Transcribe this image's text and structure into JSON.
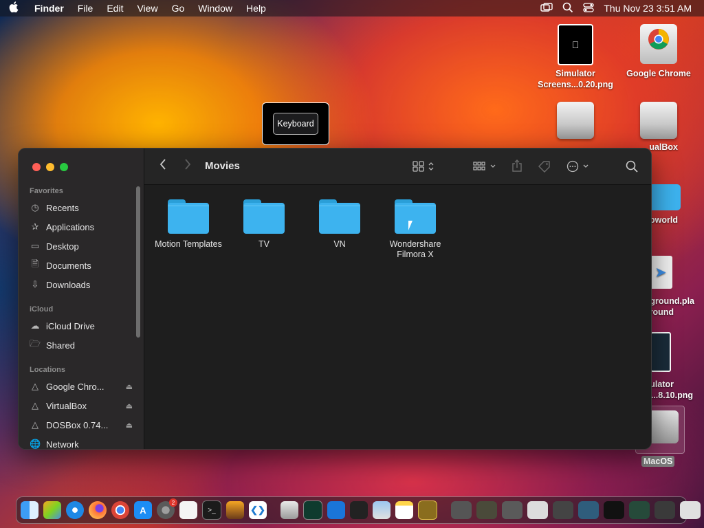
{
  "menubar": {
    "app_name": "Finder",
    "menus": [
      "File",
      "Edit",
      "View",
      "Go",
      "Window",
      "Help"
    ],
    "datetime": "Thu Nov 23  3:51 AM"
  },
  "desktop": {
    "icons": [
      {
        "line1": "Simulator",
        "line2": "Screens...0.20.png"
      },
      {
        "line1": "Google Chrome",
        "line2": ""
      },
      {
        "line1": "ualBox",
        "line2": ""
      },
      {
        "line1": "loworld",
        "line2": ""
      },
      {
        "line1": "ground.pla",
        "line2": "round"
      },
      {
        "line1": "nulator",
        "line2": "s...8.10.png"
      },
      {
        "line1": "MacOS",
        "line2": ""
      }
    ]
  },
  "keyboard_popup": {
    "label": "Keyboard"
  },
  "finder": {
    "title": "Movies",
    "sidebar": {
      "favorites_label": "Favorites",
      "favorites": [
        "Recents",
        "Applications",
        "Desktop",
        "Documents",
        "Downloads"
      ],
      "icloud_label": "iCloud",
      "icloud": [
        "iCloud Drive",
        "Shared"
      ],
      "locations_label": "Locations",
      "locations": [
        "Google Chro...",
        "VirtualBox",
        "DOSBox 0.74...",
        "Network"
      ]
    },
    "files": [
      {
        "name_line1": "Motion Templates",
        "name_line2": ""
      },
      {
        "name_line1": "TV",
        "name_line2": ""
      },
      {
        "name_line1": "VN",
        "name_line2": ""
      },
      {
        "name_line1": "Wondershare",
        "name_line2": "Filmora X"
      }
    ]
  },
  "dock": {
    "settings_badge": "2"
  },
  "colors": {
    "folder_blue": "#3db3ef",
    "close": "#ff5f57",
    "minimize": "#febc2e",
    "zoom": "#28c840"
  }
}
